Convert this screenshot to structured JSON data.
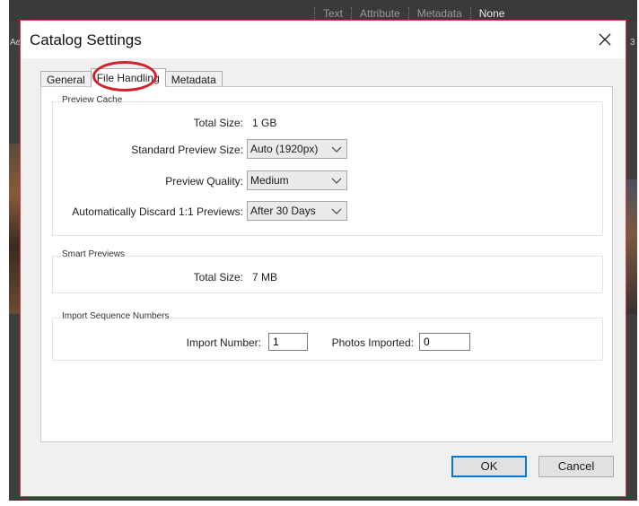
{
  "background": {
    "filter_bar": [
      "Text",
      "Attribute",
      "Metadata",
      "None"
    ],
    "filter_active": "None",
    "corner_left": "Ae",
    "corner_right": "3"
  },
  "dialog": {
    "title": "Catalog Settings",
    "close_icon": "close-icon",
    "tabs": [
      {
        "label": "General",
        "active": false
      },
      {
        "label": "File Handling",
        "active": true
      },
      {
        "label": "Metadata",
        "active": false
      }
    ],
    "preview_cache": {
      "title": "Preview Cache",
      "total_size_label": "Total Size:",
      "total_size_value": "1 GB",
      "standard_preview_label": "Standard Preview Size:",
      "standard_preview_value": "Auto (1920px)",
      "quality_label": "Preview Quality:",
      "quality_value": "Medium",
      "discard_label": "Automatically Discard 1:1 Previews:",
      "discard_value": "After 30 Days"
    },
    "smart_previews": {
      "title": "Smart Previews",
      "total_size_label": "Total Size:",
      "total_size_value": "7 MB"
    },
    "import_sequence": {
      "title": "Import Sequence Numbers",
      "import_number_label": "Import Number:",
      "import_number_value": "1",
      "photos_imported_label": "Photos Imported:",
      "photos_imported_value": "0"
    },
    "buttons": {
      "ok": "OK",
      "cancel": "Cancel"
    },
    "accent_color": "#0078d7",
    "highlight_color": "#d4202b"
  }
}
